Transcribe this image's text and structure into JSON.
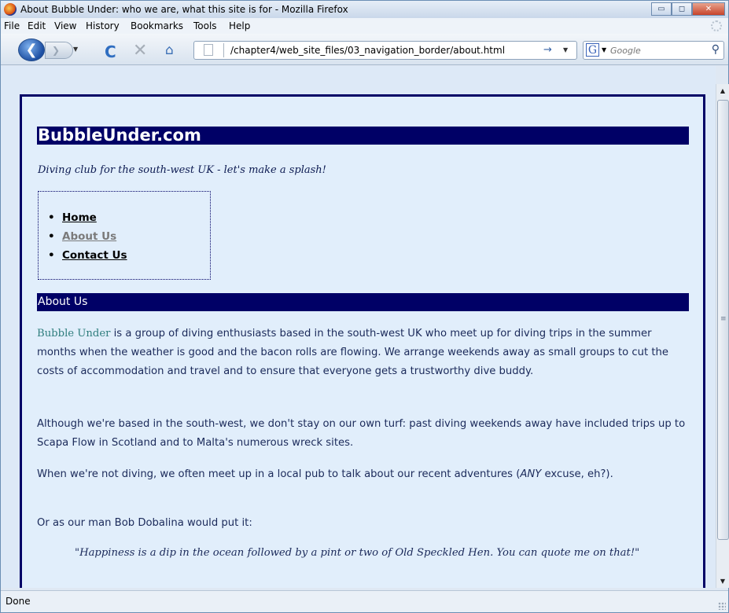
{
  "window": {
    "title": "About Bubble Under: who we are, what this site is for - Mozilla Firefox",
    "minimize": "▭",
    "maximize": "◻",
    "close": "✕"
  },
  "menubar": {
    "items": [
      "File",
      "Edit",
      "View",
      "History",
      "Bookmarks",
      "Tools",
      "Help"
    ]
  },
  "navbar": {
    "back_glyph": "❮",
    "forward_glyph": "❯",
    "dropdown_glyph": "▼",
    "reload_glyph": "C",
    "stop_glyph": "✕",
    "home_glyph": "⌂",
    "url": "/chapter4/web_site_files/03_navigation_border/about.html",
    "go_glyph": "→",
    "search_engine_glyph": "G",
    "search_placeholder": "Google",
    "search_glyph": "⚲"
  },
  "page": {
    "site_title": "BubbleUnder.com",
    "tagline": "Diving club for the south-west UK - let's make a splash!",
    "nav": [
      {
        "label": "Home",
        "current": false
      },
      {
        "label": "About Us",
        "current": true
      },
      {
        "label": "Contact Us",
        "current": false
      }
    ],
    "section_title": "About Us",
    "p1_brand": "Bubble Under",
    "p1_rest": " is a group of diving enthusiasts based in the south-west UK who meet up for diving trips in the summer months when the weather is good and the bacon rolls are flowing. We arrange weekends away as small groups to cut the costs of accommodation and travel and to ensure that everyone gets a trustworthy dive buddy.",
    "p2": "Although we're based in the south-west, we don't stay on our own turf: past diving weekends away have included trips up to Scapa Flow in Scotland and to Malta's numerous wreck sites.",
    "p3_a": "When we're not diving, we often meet up in a local pub to talk about our recent adventures (",
    "p3_em": "ANY",
    "p3_b": " excuse, eh?).",
    "p4": "Or as our man Bob Dobalina would put it:",
    "quote": "\"Happiness is a dip in the ocean followed by a pint or two of Old Speckled Hen. You can quote me on that!\""
  },
  "scrollbar": {
    "up": "▲",
    "down": "▼",
    "grip": "≡"
  },
  "statusbar": {
    "status": "Done"
  }
}
